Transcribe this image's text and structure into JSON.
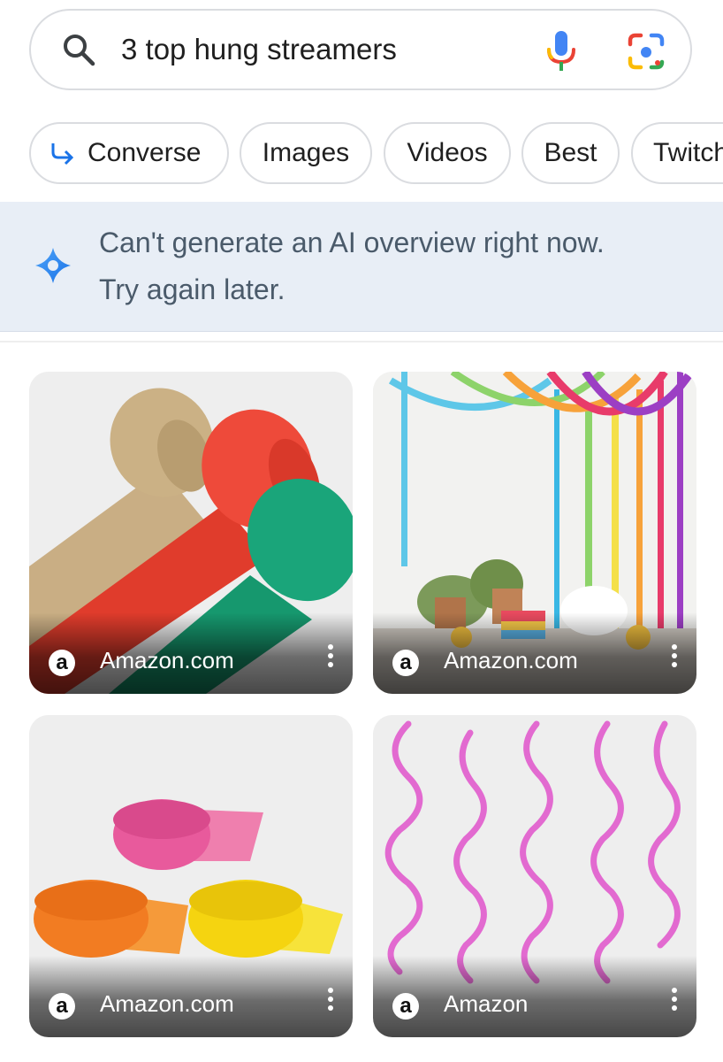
{
  "search": {
    "query": "3 top hung streamers"
  },
  "chips": [
    {
      "label": "Converse"
    },
    {
      "label": "Images"
    },
    {
      "label": "Videos"
    },
    {
      "label": "Best"
    },
    {
      "label": "Twitch"
    }
  ],
  "ai_overview": {
    "line1": "Can't generate an AI overview right now.",
    "line2": "Try again later."
  },
  "results": [
    {
      "source": "Amazon.com",
      "icon": "amazon-logo",
      "image": "crepe-paper-streamer-rolls"
    },
    {
      "source": "Amazon.com",
      "icon": "amazon-logo",
      "image": "party-table-hanging-streamers"
    },
    {
      "source": "Amazon.com",
      "icon": "amazon-logo",
      "image": "crepe-paper-rolls-pink-orange-yellow"
    },
    {
      "source": "Amazon",
      "icon": "amazon-logo",
      "image": "pink-swirl-hanging-decorations"
    }
  ],
  "amazon_logo_letter": "a",
  "colors": {
    "accent_blue": "#1a73e8",
    "banner_bg": "#e8eef6",
    "chip_border": "#dadce0"
  }
}
